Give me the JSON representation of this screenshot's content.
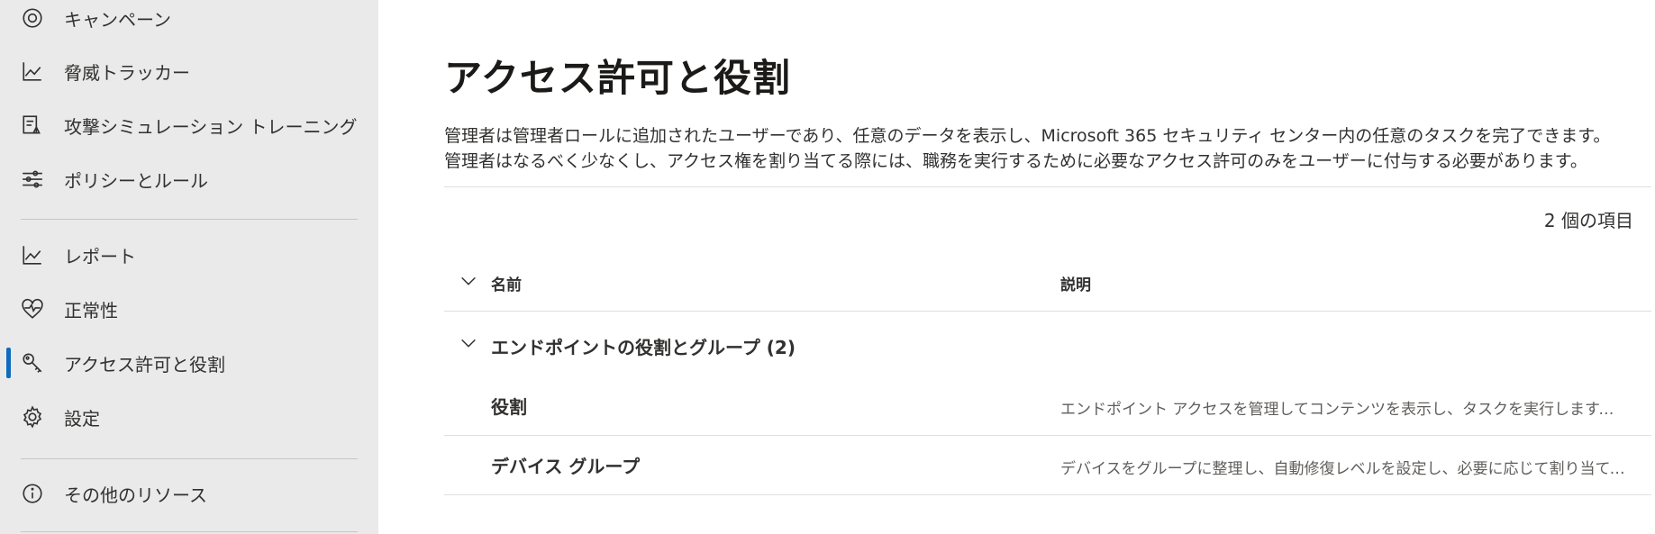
{
  "sidebar": {
    "items": [
      {
        "label": "キャンペーン",
        "icon": "target-icon"
      },
      {
        "label": "脅威トラッカー",
        "icon": "chart-line-icon"
      },
      {
        "label": "攻撃シミュレーション トレーニング",
        "icon": "simulation-icon"
      },
      {
        "label": "ポリシーとルール",
        "icon": "sliders-icon"
      },
      {
        "label": "レポート",
        "icon": "chart-line-icon"
      },
      {
        "label": "正常性",
        "icon": "heart-pulse-icon"
      },
      {
        "label": "アクセス許可と役割",
        "icon": "key-icon",
        "active": true
      },
      {
        "label": "設定",
        "icon": "gear-icon"
      },
      {
        "label": "その他のリソース",
        "icon": "info-icon"
      }
    ]
  },
  "main": {
    "title": "アクセス許可と役割",
    "description": "管理者は管理者ロールに追加されたユーザーであり、任意のデータを表示し、Microsoft 365 セキュリティ センター内の任意のタスクを完了できます。管理者はなるべく少なくし、アクセス権を割り当てる際には、職務を実行するために必要なアクセス許可のみをユーザーに付与する必要があります。",
    "item_count": "2 個の項目",
    "columns": {
      "name": "名前",
      "description": "説明"
    },
    "group": {
      "label": "エンドポイントの役割とグループ (2)"
    },
    "rows": [
      {
        "name": "役割",
        "description": "エンドポイント アクセスを管理してコンテンツを表示し、タスクを実行します。以下のみを付与..."
      },
      {
        "name": "デバイス グループ",
        "description": "デバイスをグループに整理し、自動修復レベルを設定し、必要に応じて割り当てます..."
      }
    ]
  },
  "colors": {
    "sidebar_bg": "#eaeaea",
    "active_indicator": "#0f6cbd",
    "divider": "#e1dfdd"
  }
}
